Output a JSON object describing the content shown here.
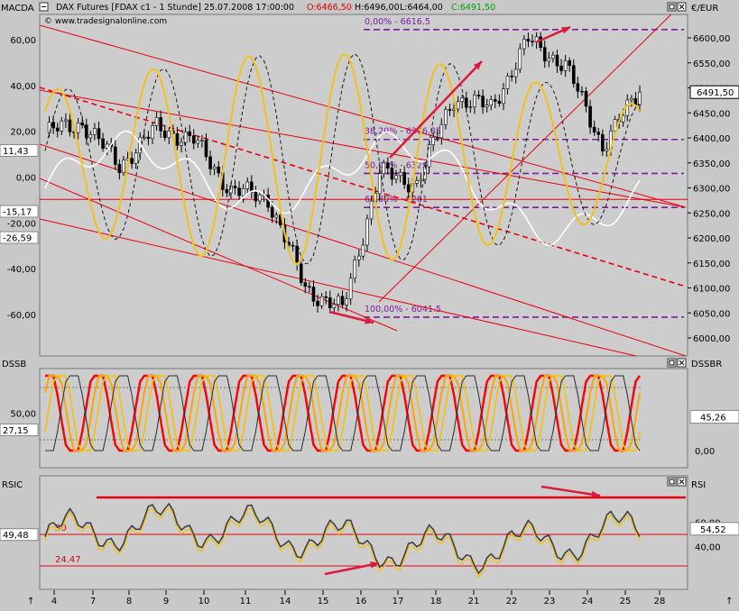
{
  "header": {
    "title": "DAX Futures [FDAX c1 - 1 Stunde] 25.07.2008 17:00:00",
    "open": "O:6466,50",
    "high": "H:6496,00",
    "low": "L:6464,00",
    "close": "C:6491,50",
    "watermark": "© www.tradesignalonline.com",
    "left_panel_label": "MACDA",
    "right_panel_label": "€/EUR"
  },
  "colors": {
    "background": "#c8c8c8",
    "plot_bg": "#cdcdcd",
    "candle": "#000000",
    "macd_yellow": "#f2c21a",
    "macd_dashed": "#1a1a1a",
    "white_line": "#ffffff",
    "trend_red": "#e8000e",
    "fib_purple": "#7a1f9c",
    "arrow": "#dd1a3c",
    "dssb_red": "#ff0000",
    "dssb_orange": "#ffa500",
    "dssb_yellow": "#f2c21a",
    "rsi_dark": "#404040"
  },
  "x_axis": {
    "labels": [
      "4",
      "7",
      "8",
      "9",
      "10",
      "11",
      "14",
      "15",
      "16",
      "17",
      "18",
      "21",
      "22",
      "23",
      "24",
      "25",
      "28"
    ]
  },
  "price_panel": {
    "right_ticks": [
      "6600,00",
      "6550,00",
      "6500,00",
      "6450,00",
      "6400,00",
      "6350,00",
      "6300,00",
      "6250,00",
      "6200,00",
      "6150,00",
      "6100,00",
      "6050,00",
      "6000,00"
    ],
    "left_ticks": [
      "60,00",
      "40,00",
      "20,00",
      "0,00",
      "-20,00",
      "-40,00",
      "-60,00"
    ],
    "left_markers": [
      "11,43",
      "-15,17",
      "-26,59"
    ],
    "last_price": "6491,50",
    "fib_labels": [
      "0,00% - 6616.5",
      "38,20% - 6396.85",
      "50,00% - 6329",
      "61,80% - 6261",
      "100,00% - 6041.5"
    ]
  },
  "dssb_panel": {
    "left_label": "DSSB",
    "right_label": "DSSBR",
    "left_ticks": [
      "50,00"
    ],
    "left_marker": "27,15",
    "right_ticks": [
      "0,00"
    ],
    "right_marker": "45,26"
  },
  "rsi_panel": {
    "left_label": "RSIC",
    "right_label": "RSI",
    "left_marker": "49,48",
    "right_ticks": [
      "60,00",
      "40,00"
    ],
    "right_marker": "54,52",
    "level_50": "50",
    "level_low": "24.47"
  },
  "chart_data": {
    "type": "candlestick",
    "symbol": "DAX Futures [FDAX c1 - 1 Stunde]",
    "x_dates": [
      "4",
      "7",
      "8",
      "9",
      "10",
      "11",
      "14",
      "15",
      "16",
      "17",
      "18",
      "21",
      "22",
      "23",
      "24",
      "25",
      "28"
    ],
    "price_range": [
      5980,
      6640
    ],
    "close_path": [
      {
        "x": "4",
        "price": 6410
      },
      {
        "x": "7",
        "price": 6430
      },
      {
        "x": "8",
        "price": 6345
      },
      {
        "x": "9",
        "price": 6420
      },
      {
        "x": "10",
        "price": 6395
      },
      {
        "x": "11",
        "price": 6295
      },
      {
        "x": "14",
        "price": 6280
      },
      {
        "x": "15",
        "price": 6100
      },
      {
        "x": "16",
        "price": 6055
      },
      {
        "x": "17",
        "price": 6330
      },
      {
        "x": "18",
        "price": 6310
      },
      {
        "x": "21",
        "price": 6480
      },
      {
        "x": "22",
        "price": 6460
      },
      {
        "x": "23",
        "price": 6595
      },
      {
        "x": "24",
        "price": 6545
      },
      {
        "x": "25",
        "price": 6385
      },
      {
        "x": "25",
        "price": 6491.5
      }
    ],
    "fibonacci": [
      {
        "level": "0,00%",
        "price": 6616.5
      },
      {
        "level": "38,20%",
        "price": 6396.85
      },
      {
        "level": "50,00%",
        "price": 6329
      },
      {
        "level": "61,80%",
        "price": 6261
      },
      {
        "level": "100,00%",
        "price": 6041.5
      }
    ],
    "horizontal_lines": [
      6277
    ],
    "macd_range": [
      -75,
      70
    ],
    "dssb_range": [
      0,
      100
    ],
    "rsi_levels": [
      50,
      24.47
    ],
    "last": {
      "price": 6491.5,
      "macd": 11.43,
      "dssb": 27.15,
      "dssbr": 45.26,
      "rsic": 49.48,
      "rsi": 54.52
    }
  }
}
